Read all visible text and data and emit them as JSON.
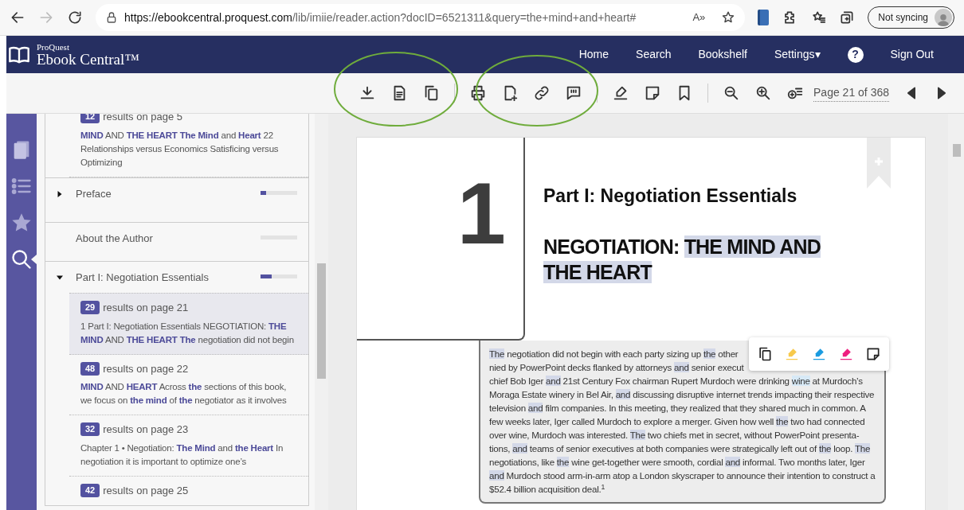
{
  "browser": {
    "url_host": "https://ebookcentral.proquest.com",
    "url_path": "/lib/imiie/reader.action?docID=6521311&query=the+mind+and+heart#",
    "profile_label": "Not syncing",
    "read_aloud_label": "A»"
  },
  "header": {
    "brand_small": "ProQuest",
    "brand_large": "Ebook Central™",
    "nav": [
      "Home",
      "Search",
      "Bookshelf",
      "Settings▾"
    ],
    "help": "?",
    "sign_out": "Sign Out"
  },
  "toolbar": {
    "buttons": [
      {
        "kind": "download"
      },
      {
        "kind": "pdf"
      },
      {
        "kind": "copy"
      },
      {
        "kind": "sep"
      },
      {
        "kind": "print"
      },
      {
        "kind": "add"
      },
      {
        "kind": "link"
      },
      {
        "kind": "cite"
      },
      {
        "kind": "sep"
      },
      {
        "kind": "highlight"
      },
      {
        "kind": "note"
      },
      {
        "kind": "bookmark"
      },
      {
        "kind": "sep"
      },
      {
        "kind": "zoom-out"
      },
      {
        "kind": "zoom-in"
      },
      {
        "kind": "fit"
      }
    ],
    "page_indicator": "Page 21 of 368"
  },
  "rail": [
    {
      "kind": "book",
      "selected": false
    },
    {
      "kind": "list",
      "selected": false
    },
    {
      "kind": "star",
      "selected": false
    },
    {
      "kind": "search",
      "selected": true
    }
  ],
  "sidebar": {
    "items": [
      {
        "kind": "result",
        "count": "12",
        "label": "results on page 5",
        "snippet": "**MIND** AND **THE HEART The Mind** and **Heart** 22 Relationships versus Economics Satisficing versus Optimizing",
        "selected": false
      },
      {
        "kind": "section",
        "title": "Preface",
        "expanded": false,
        "level": 0.15
      },
      {
        "kind": "leaf",
        "title": "About the Author",
        "level": 0
      },
      {
        "kind": "section",
        "title": "Part I: Negotiation Essentials",
        "expanded": true,
        "level": 0.3,
        "children": [
          {
            "kind": "result",
            "count": "29",
            "label": "results on page 21",
            "snippet": "1 Part I: Negotiation Essentials NEGOTIATION: **THE MIND** AND **THE HEART The** negotiation did not begin",
            "selected": true
          },
          {
            "kind": "result",
            "count": "48",
            "label": "results on page 22",
            "snippet": "**MIND** AND **HEART** Across **the** sections of this book, we focus on **the mind** of **the** negotiator as it involves",
            "selected": false
          },
          {
            "kind": "result",
            "count": "32",
            "label": "results on page 23",
            "snippet": "Chapter 1 • Negotiation: **The Mind** and **the Heart** In negotiation it is important to optimize one’s",
            "selected": false
          },
          {
            "kind": "result",
            "count": "42",
            "label": "results on page 25",
            "selected": false
          }
        ]
      }
    ]
  },
  "page": {
    "chapter_number": "1",
    "part_title": "Part I: Negotiation Essentials",
    "title": [
      {
        "text": "NEGOTIATION: "
      },
      {
        "text": "THE MIND AND THE HEART",
        "color": "#d3d8e8"
      }
    ],
    "lines": [
      [
        {
          "text": "The",
          "color": "#d3d8e8"
        },
        {
          "text": " negotiation did not begin with each party sizing up "
        },
        {
          "text": "the",
          "color": "#d3d8e8"
        },
        {
          "text": " other"
        }
      ],
      [
        {
          "text": "nied by PowerPoint decks flanked by attorneys "
        },
        {
          "text": "and",
          "color": "#d3d8e8"
        },
        {
          "text": " senior execut"
        }
      ],
      [
        {
          "text": "chief Bob Iger "
        },
        {
          "text": "and",
          "color": "#d3d8e8"
        },
        {
          "text": " 21st Century Fox chairman Rupert Murdoch were drinking "
        },
        {
          "text": "wine",
          "color": "#d7e9f6"
        },
        {
          "text": " at Murdoch’s"
        }
      ],
      [
        {
          "text": "Moraga Estate winery in Bel Air, "
        },
        {
          "text": "and",
          "color": "#d3d8e8"
        },
        {
          "text": " discussing disruptive internet trends impacting their respective"
        }
      ],
      [
        {
          "text": "television "
        },
        {
          "text": "and",
          "color": "#d3d8e8"
        },
        {
          "text": " film companies. In this meeting, they realized that they shared much in common. A"
        }
      ],
      [
        {
          "text": "few weeks later, Iger called Murdoch to explore a merger. Given how well "
        },
        {
          "text": "the",
          "color": "#d3d8e8"
        },
        {
          "text": " two had connected"
        }
      ],
      [
        {
          "text": "over wine, Murdoch was interested. "
        },
        {
          "text": "The",
          "color": "#d3d8e8"
        },
        {
          "text": " two chiefs met in secret, without PowerPoint presenta-"
        }
      ],
      [
        {
          "text": "tions, "
        },
        {
          "text": "and",
          "color": "#d3d8e8"
        },
        {
          "text": " teams of senior executives at both companies were strategically left out of "
        },
        {
          "text": "the",
          "color": "#d3d8e8"
        },
        {
          "text": " loop. "
        },
        {
          "text": "The",
          "color": "#d3d8e8"
        }
      ],
      [
        {
          "text": "negotiations, like "
        },
        {
          "text": "the",
          "color": "#d3d8e8"
        },
        {
          "text": " wine get-together were smooth, cordial "
        },
        {
          "text": "and",
          "color": "#d3d8e8"
        },
        {
          "text": " informal. Two months later, Iger"
        }
      ],
      [
        {
          "text": "and",
          "color": "#d3d8e8"
        },
        {
          "text": " Murdoch stood arm-in-arm atop a London skyscraper to announce their intention to construct a"
        }
      ],
      [
        {
          "text": "$52.4 billion acquisition deal.$^{1}$"
        }
      ]
    ],
    "popup": [
      {
        "kind": "copy"
      },
      {
        "kind": "marker",
        "color": "#f7c94b"
      },
      {
        "kind": "marker",
        "color": "#1a9be0"
      },
      {
        "kind": "marker",
        "color": "#ee1f80"
      },
      {
        "kind": "note"
      }
    ]
  }
}
